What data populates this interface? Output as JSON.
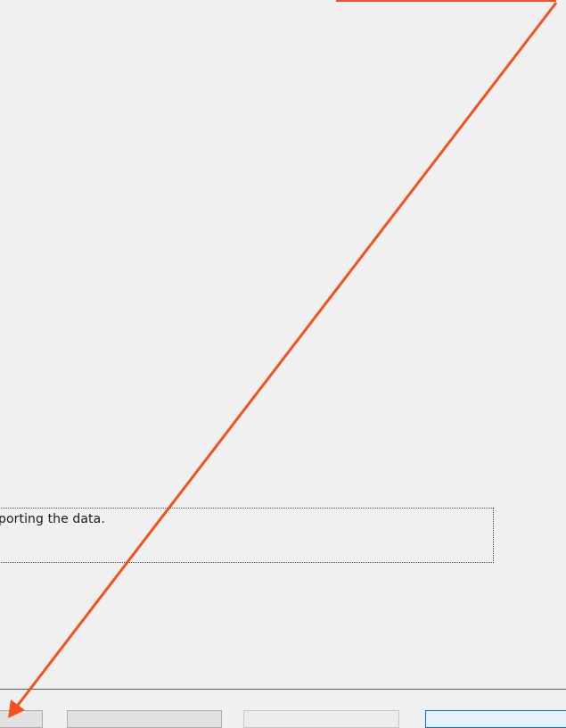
{
  "dialog": {
    "info_text": "nporting the data."
  },
  "buttons": {
    "partial_left_label": "",
    "back_label": "",
    "next_label": "",
    "finish_label": ""
  },
  "colors": {
    "annotation": "#f4511e",
    "focus_border": "#0078d7"
  }
}
